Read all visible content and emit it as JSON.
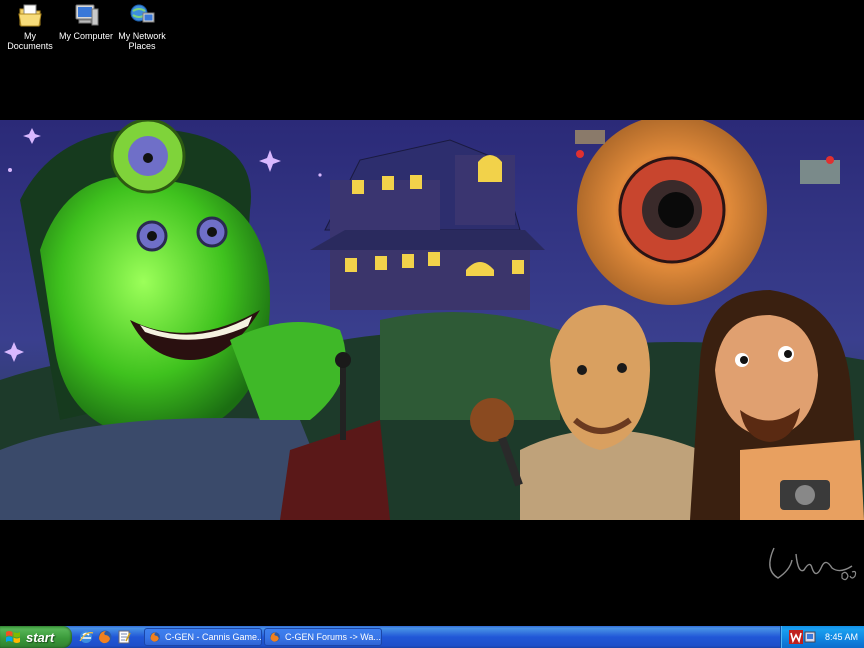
{
  "desktop": {
    "icons": [
      {
        "label": "My Documents",
        "icon": "my-documents-icon"
      },
      {
        "label": "My Computer",
        "icon": "my-computer-icon"
      },
      {
        "label": "My Network Places",
        "icon": "my-network-places-icon"
      }
    ],
    "signature": "Ja y 05"
  },
  "taskbar": {
    "start_label": "start",
    "quick_launch": [
      "internet-explorer-icon",
      "firefox-icon",
      "notepad-icon"
    ],
    "tasks": [
      {
        "label": "C-GEN - Cannis Game...",
        "icon": "firefox-icon"
      },
      {
        "label": "C-GEN Forums -> Wa...",
        "icon": "firefox-icon"
      }
    ],
    "clock": "8:45 AM"
  },
  "colors": {
    "taskbar_blue": "#245edb",
    "start_green": "#3c9b3c",
    "tray_blue": "#0f84e0"
  }
}
